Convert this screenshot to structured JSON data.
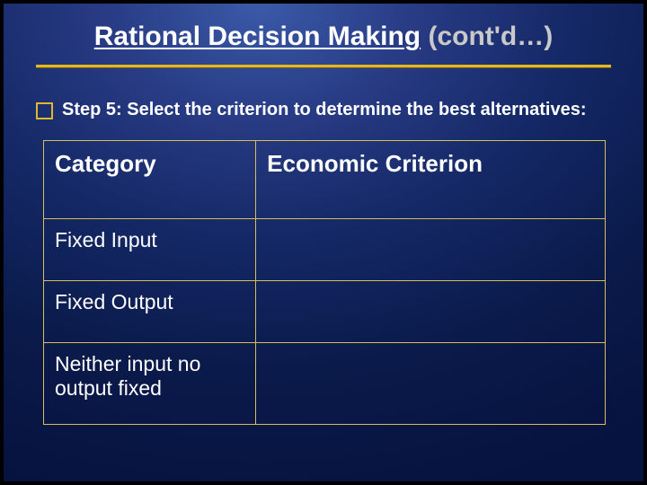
{
  "title": {
    "main": "Rational Decision Making",
    "tail": " (cont'd…)"
  },
  "bullet": {
    "text": "Step 5: Select the criterion to determine the best alternatives:"
  },
  "table": {
    "header": {
      "col_a": "Category",
      "col_b": "Economic Criterion"
    },
    "rows": [
      {
        "a": "Fixed Input",
        "b": ""
      },
      {
        "a": "Fixed Output",
        "b": ""
      },
      {
        "a": "Neither input no output fixed",
        "b": ""
      }
    ]
  }
}
